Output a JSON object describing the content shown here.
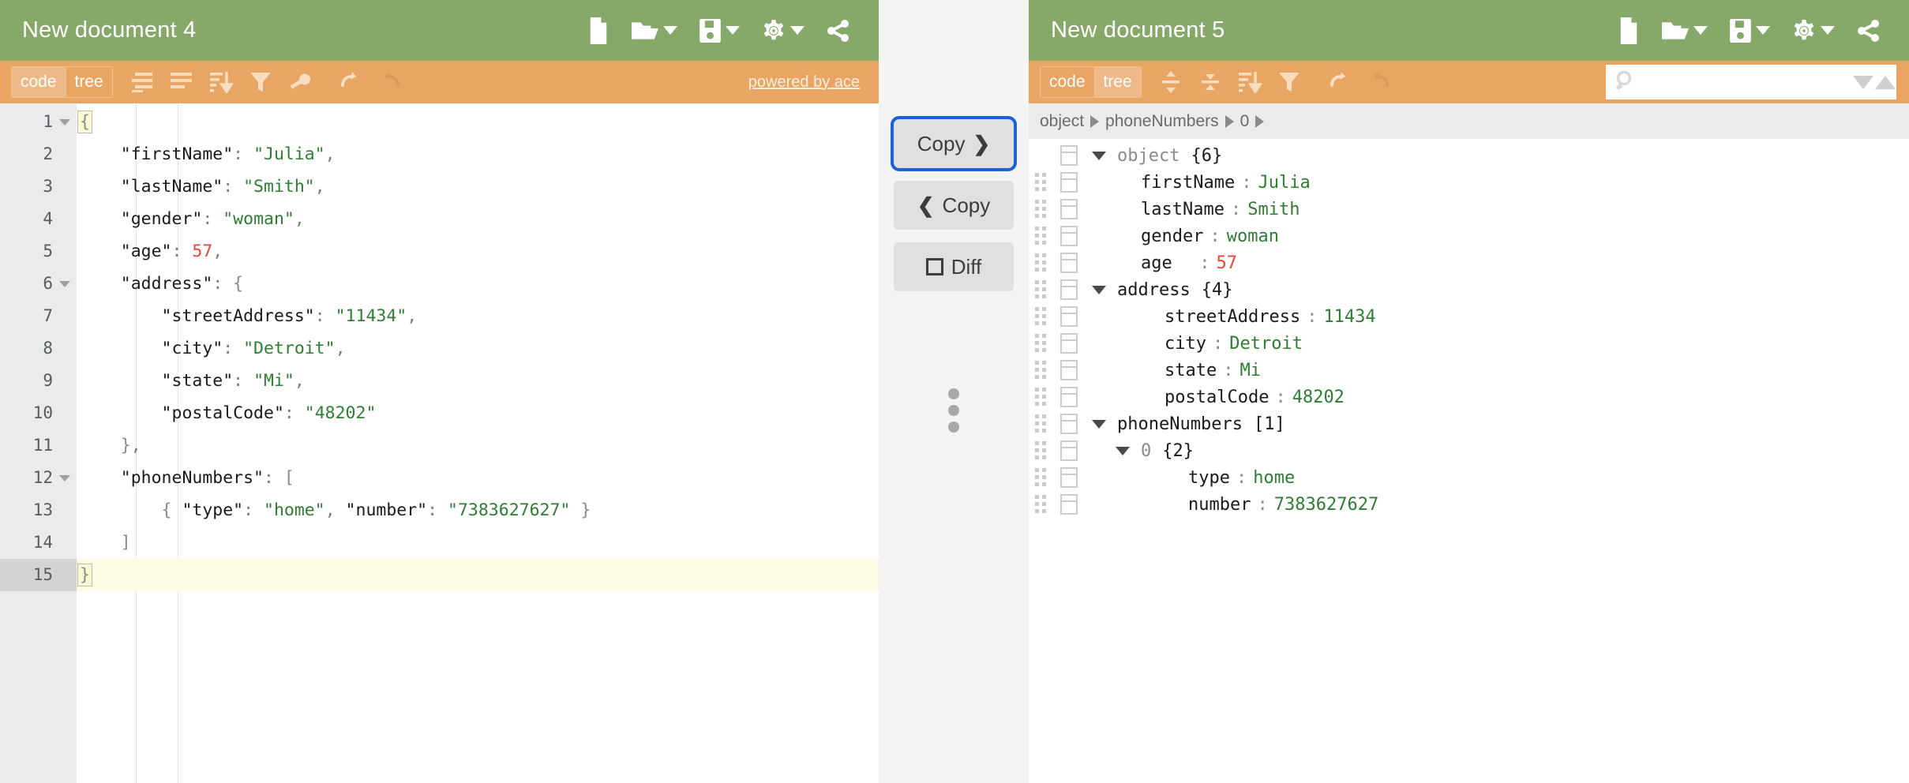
{
  "left": {
    "title": "New document 4",
    "menu_icons": [
      {
        "name": "new-document-icon",
        "label": "New"
      },
      {
        "name": "open-folder-icon",
        "label": "Open"
      },
      {
        "name": "save-icon",
        "label": "Save"
      },
      {
        "name": "gear-icon",
        "label": "Settings"
      },
      {
        "name": "share-icon",
        "label": "Share"
      }
    ],
    "modes": [
      {
        "label": "code",
        "active": true
      },
      {
        "label": "tree",
        "active": false
      }
    ],
    "tools": [
      {
        "name": "compact-icon",
        "label": "Compact JSON data"
      },
      {
        "name": "format-icon",
        "label": "Format JSON data"
      },
      {
        "name": "sort-icon",
        "label": "Sort contents"
      },
      {
        "name": "filter-icon",
        "label": "Filter, sort, or transform contents"
      },
      {
        "name": "repair-icon",
        "label": "Repair JSON"
      },
      {
        "name": "undo-icon",
        "label": "Undo"
      },
      {
        "name": "redo-icon",
        "label": "Redo"
      }
    ],
    "powered_by": "powered by ace",
    "code_lines": [
      {
        "num": "1",
        "fold": true,
        "active": false,
        "tokens": [
          {
            "t": "{",
            "c": "brace-hl b"
          }
        ]
      },
      {
        "num": "2",
        "fold": false,
        "active": false,
        "tokens": [
          {
            "t": "    \"firstName\"",
            "c": "k"
          },
          {
            "t": ": ",
            "c": "p"
          },
          {
            "t": "\"Julia\"",
            "c": "s"
          },
          {
            "t": ",",
            "c": "p"
          }
        ]
      },
      {
        "num": "3",
        "fold": false,
        "active": false,
        "tokens": [
          {
            "t": "    \"lastName\"",
            "c": "k"
          },
          {
            "t": ": ",
            "c": "p"
          },
          {
            "t": "\"Smith\"",
            "c": "s"
          },
          {
            "t": ",",
            "c": "p"
          }
        ]
      },
      {
        "num": "4",
        "fold": false,
        "active": false,
        "tokens": [
          {
            "t": "    \"gender\"",
            "c": "k"
          },
          {
            "t": ": ",
            "c": "p"
          },
          {
            "t": "\"woman\"",
            "c": "s"
          },
          {
            "t": ",",
            "c": "p"
          }
        ]
      },
      {
        "num": "5",
        "fold": false,
        "active": false,
        "tokens": [
          {
            "t": "    \"age\"",
            "c": "k"
          },
          {
            "t": ": ",
            "c": "p"
          },
          {
            "t": "57",
            "c": "n"
          },
          {
            "t": ",",
            "c": "p"
          }
        ]
      },
      {
        "num": "6",
        "fold": true,
        "active": false,
        "tokens": [
          {
            "t": "    \"address\"",
            "c": "k"
          },
          {
            "t": ": ",
            "c": "p"
          },
          {
            "t": "{",
            "c": "b"
          }
        ]
      },
      {
        "num": "7",
        "fold": false,
        "active": false,
        "tokens": [
          {
            "t": "        \"streetAddress\"",
            "c": "k"
          },
          {
            "t": ": ",
            "c": "p"
          },
          {
            "t": "\"11434\"",
            "c": "s"
          },
          {
            "t": ",",
            "c": "p"
          }
        ]
      },
      {
        "num": "8",
        "fold": false,
        "active": false,
        "tokens": [
          {
            "t": "        \"city\"",
            "c": "k"
          },
          {
            "t": ": ",
            "c": "p"
          },
          {
            "t": "\"Detroit\"",
            "c": "s"
          },
          {
            "t": ",",
            "c": "p"
          }
        ]
      },
      {
        "num": "9",
        "fold": false,
        "active": false,
        "tokens": [
          {
            "t": "        \"state\"",
            "c": "k"
          },
          {
            "t": ": ",
            "c": "p"
          },
          {
            "t": "\"Mi\"",
            "c": "s"
          },
          {
            "t": ",",
            "c": "p"
          }
        ]
      },
      {
        "num": "10",
        "fold": false,
        "active": false,
        "tokens": [
          {
            "t": "        \"postalCode\"",
            "c": "k"
          },
          {
            "t": ": ",
            "c": "p"
          },
          {
            "t": "\"48202\"",
            "c": "s"
          }
        ]
      },
      {
        "num": "11",
        "fold": false,
        "active": false,
        "tokens": [
          {
            "t": "    }",
            "c": "b"
          },
          {
            "t": ",",
            "c": "p"
          }
        ]
      },
      {
        "num": "12",
        "fold": true,
        "active": false,
        "tokens": [
          {
            "t": "    \"phoneNumbers\"",
            "c": "k"
          },
          {
            "t": ": ",
            "c": "p"
          },
          {
            "t": "[",
            "c": "b"
          }
        ]
      },
      {
        "num": "13",
        "fold": false,
        "active": false,
        "tokens": [
          {
            "t": "        { ",
            "c": "b"
          },
          {
            "t": "\"type\"",
            "c": "k"
          },
          {
            "t": ": ",
            "c": "p"
          },
          {
            "t": "\"home\"",
            "c": "s"
          },
          {
            "t": ", ",
            "c": "p"
          },
          {
            "t": "\"number\"",
            "c": "k"
          },
          {
            "t": ": ",
            "c": "p"
          },
          {
            "t": "\"7383627627\"",
            "c": "s"
          },
          {
            "t": " }",
            "c": "b"
          }
        ]
      },
      {
        "num": "14",
        "fold": false,
        "active": false,
        "tokens": [
          {
            "t": "    ]",
            "c": "b"
          }
        ]
      },
      {
        "num": "15",
        "fold": false,
        "active": true,
        "tokens": [
          {
            "t": "}",
            "c": "brace-hl b"
          }
        ]
      }
    ]
  },
  "middle": {
    "copy_right_label": "Copy",
    "copy_right_chevron": "❯",
    "copy_left_label": "Copy",
    "copy_left_chevron": "❮",
    "diff_label": "Diff",
    "resize_handle": "resize-handle"
  },
  "right": {
    "title": "New document 5",
    "menu_icons": [
      {
        "name": "new-document-icon",
        "label": "New"
      },
      {
        "name": "open-folder-icon",
        "label": "Open"
      },
      {
        "name": "save-icon",
        "label": "Save"
      },
      {
        "name": "gear-icon",
        "label": "Settings"
      },
      {
        "name": "share-icon",
        "label": "Share"
      }
    ],
    "modes": [
      {
        "label": "code",
        "active": false
      },
      {
        "label": "tree",
        "active": true
      }
    ],
    "tools": [
      {
        "name": "expand-all-icon",
        "label": "Expand all fields"
      },
      {
        "name": "collapse-all-icon",
        "label": "Collapse all fields"
      },
      {
        "name": "sort-icon",
        "label": "Sort contents"
      },
      {
        "name": "filter-icon",
        "label": "Filter, sort, or transform contents"
      },
      {
        "name": "undo-icon",
        "label": "Undo"
      },
      {
        "name": "redo-icon",
        "label": "Redo"
      }
    ],
    "search": {
      "value": "",
      "placeholder": ""
    },
    "breadcrumb": [
      "object",
      "phoneNumbers",
      "0"
    ],
    "tree_rows": [
      {
        "handle": false,
        "indent": 0,
        "expander": "open",
        "key": "object",
        "dim": true,
        "sep": "",
        "value": "",
        "count": "{6}"
      },
      {
        "handle": true,
        "indent": 1,
        "expander": "none",
        "key": "firstName",
        "dim": false,
        "sep": ":",
        "value": "Julia",
        "vtype": "str",
        "count": ""
      },
      {
        "handle": true,
        "indent": 1,
        "expander": "none",
        "key": "lastName",
        "dim": false,
        "sep": ":",
        "value": "Smith",
        "vtype": "str",
        "count": ""
      },
      {
        "handle": true,
        "indent": 1,
        "expander": "none",
        "key": "gender",
        "dim": false,
        "sep": ":",
        "value": "woman",
        "vtype": "str",
        "count": ""
      },
      {
        "handle": true,
        "indent": 1,
        "expander": "none",
        "key": "age  ",
        "dim": false,
        "sep": ":",
        "value": "57",
        "vtype": "num",
        "count": ""
      },
      {
        "handle": true,
        "indent": 0,
        "expander": "open",
        "key": "address",
        "dim": false,
        "sep": "",
        "value": "",
        "count": "{4}"
      },
      {
        "handle": true,
        "indent": 2,
        "expander": "none",
        "key": "streetAddress",
        "dim": false,
        "sep": ":",
        "value": "11434",
        "vtype": "str",
        "count": ""
      },
      {
        "handle": true,
        "indent": 2,
        "expander": "none",
        "key": "city",
        "dim": false,
        "sep": ":",
        "value": "Detroit",
        "vtype": "str",
        "count": ""
      },
      {
        "handle": true,
        "indent": 2,
        "expander": "none",
        "key": "state",
        "dim": false,
        "sep": ":",
        "value": "Mi",
        "vtype": "str",
        "count": ""
      },
      {
        "handle": true,
        "indent": 2,
        "expander": "none",
        "key": "postalCode",
        "dim": false,
        "sep": ":",
        "value": "48202",
        "vtype": "str",
        "count": ""
      },
      {
        "handle": true,
        "indent": 0,
        "expander": "open",
        "key": "phoneNumbers",
        "dim": false,
        "sep": "",
        "value": "",
        "count": "[1]"
      },
      {
        "handle": true,
        "indent": 1,
        "expander": "open",
        "key": "0",
        "dim": true,
        "sep": "",
        "value": "",
        "count": "{2}"
      },
      {
        "handle": true,
        "indent": 3,
        "expander": "none",
        "key": "type",
        "dim": false,
        "sep": ":",
        "value": "home",
        "vtype": "str",
        "count": ""
      },
      {
        "handle": true,
        "indent": 3,
        "expander": "none",
        "key": "number",
        "dim": false,
        "sep": ":",
        "value": "7383627627",
        "vtype": "str",
        "count": ""
      }
    ]
  },
  "colors": {
    "menu_green": "#86a96a",
    "toolbar_orange": "#e8a563",
    "string_green": "#2e7d32",
    "number_red": "#e8453c",
    "focus_blue": "#1a62d6",
    "gutter_gray": "#ebebeb"
  }
}
